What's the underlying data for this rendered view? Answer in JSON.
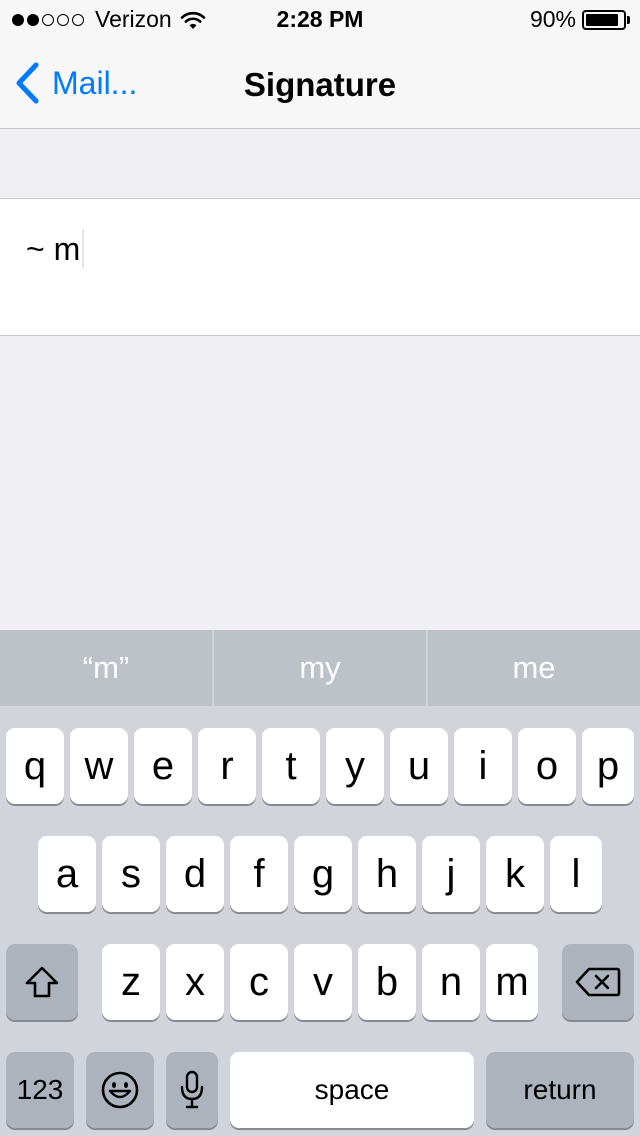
{
  "status_bar": {
    "carrier": "Verizon",
    "signal_bars_filled": 2,
    "signal_bars_total": 5,
    "time": "2:28 PM",
    "battery_percent": "90%",
    "battery_level": 0.9
  },
  "nav": {
    "back_label": "Mail...",
    "title": "Signature"
  },
  "signature": {
    "text": "~ m"
  },
  "predictive": {
    "suggestions": [
      "“m”",
      "my",
      "me"
    ]
  },
  "keyboard": {
    "row1": [
      "q",
      "w",
      "e",
      "r",
      "t",
      "y",
      "u",
      "i",
      "o",
      "p"
    ],
    "row2": [
      "a",
      "s",
      "d",
      "f",
      "g",
      "h",
      "j",
      "k",
      "l"
    ],
    "row3": [
      "z",
      "x",
      "c",
      "v",
      "b",
      "n",
      "m"
    ],
    "numbers_label": "123",
    "space_label": "space",
    "return_label": "return",
    "icons": {
      "shift": "shift-arrow-icon",
      "delete": "backspace-icon",
      "emoji": "emoji-smiley-icon",
      "dictation": "microphone-icon"
    }
  },
  "colors": {
    "accent": "#007aff",
    "keyboard_bg": "#d1d5db",
    "predictive_bg": "#bdc2c9",
    "dark_key": "#adb3bc"
  }
}
